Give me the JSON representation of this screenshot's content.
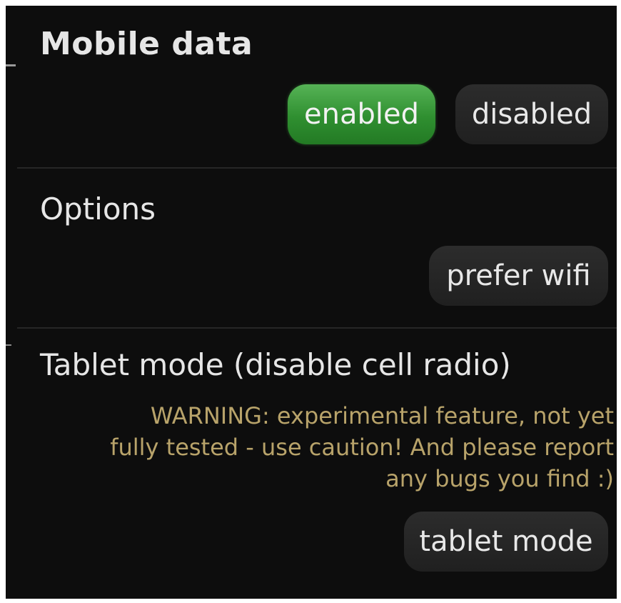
{
  "mobile_data": {
    "title": "Mobile data",
    "enabled_label": "enabled",
    "disabled_label": "disabled",
    "selected": "enabled"
  },
  "options": {
    "title": "Options",
    "prefer_wifi_label": "prefer wifi"
  },
  "tablet_mode": {
    "title": "Tablet mode (disable cell radio)",
    "warning_lines": [
      "WARNING: experimental feature, not yet",
      "fully tested - use caution! And please report",
      "any bugs you find :)"
    ],
    "button_label": "tablet mode"
  },
  "colors": {
    "background": "#0d0d0d",
    "active_accent": "#3a9a3a",
    "warning_text": "#b8a36a"
  }
}
